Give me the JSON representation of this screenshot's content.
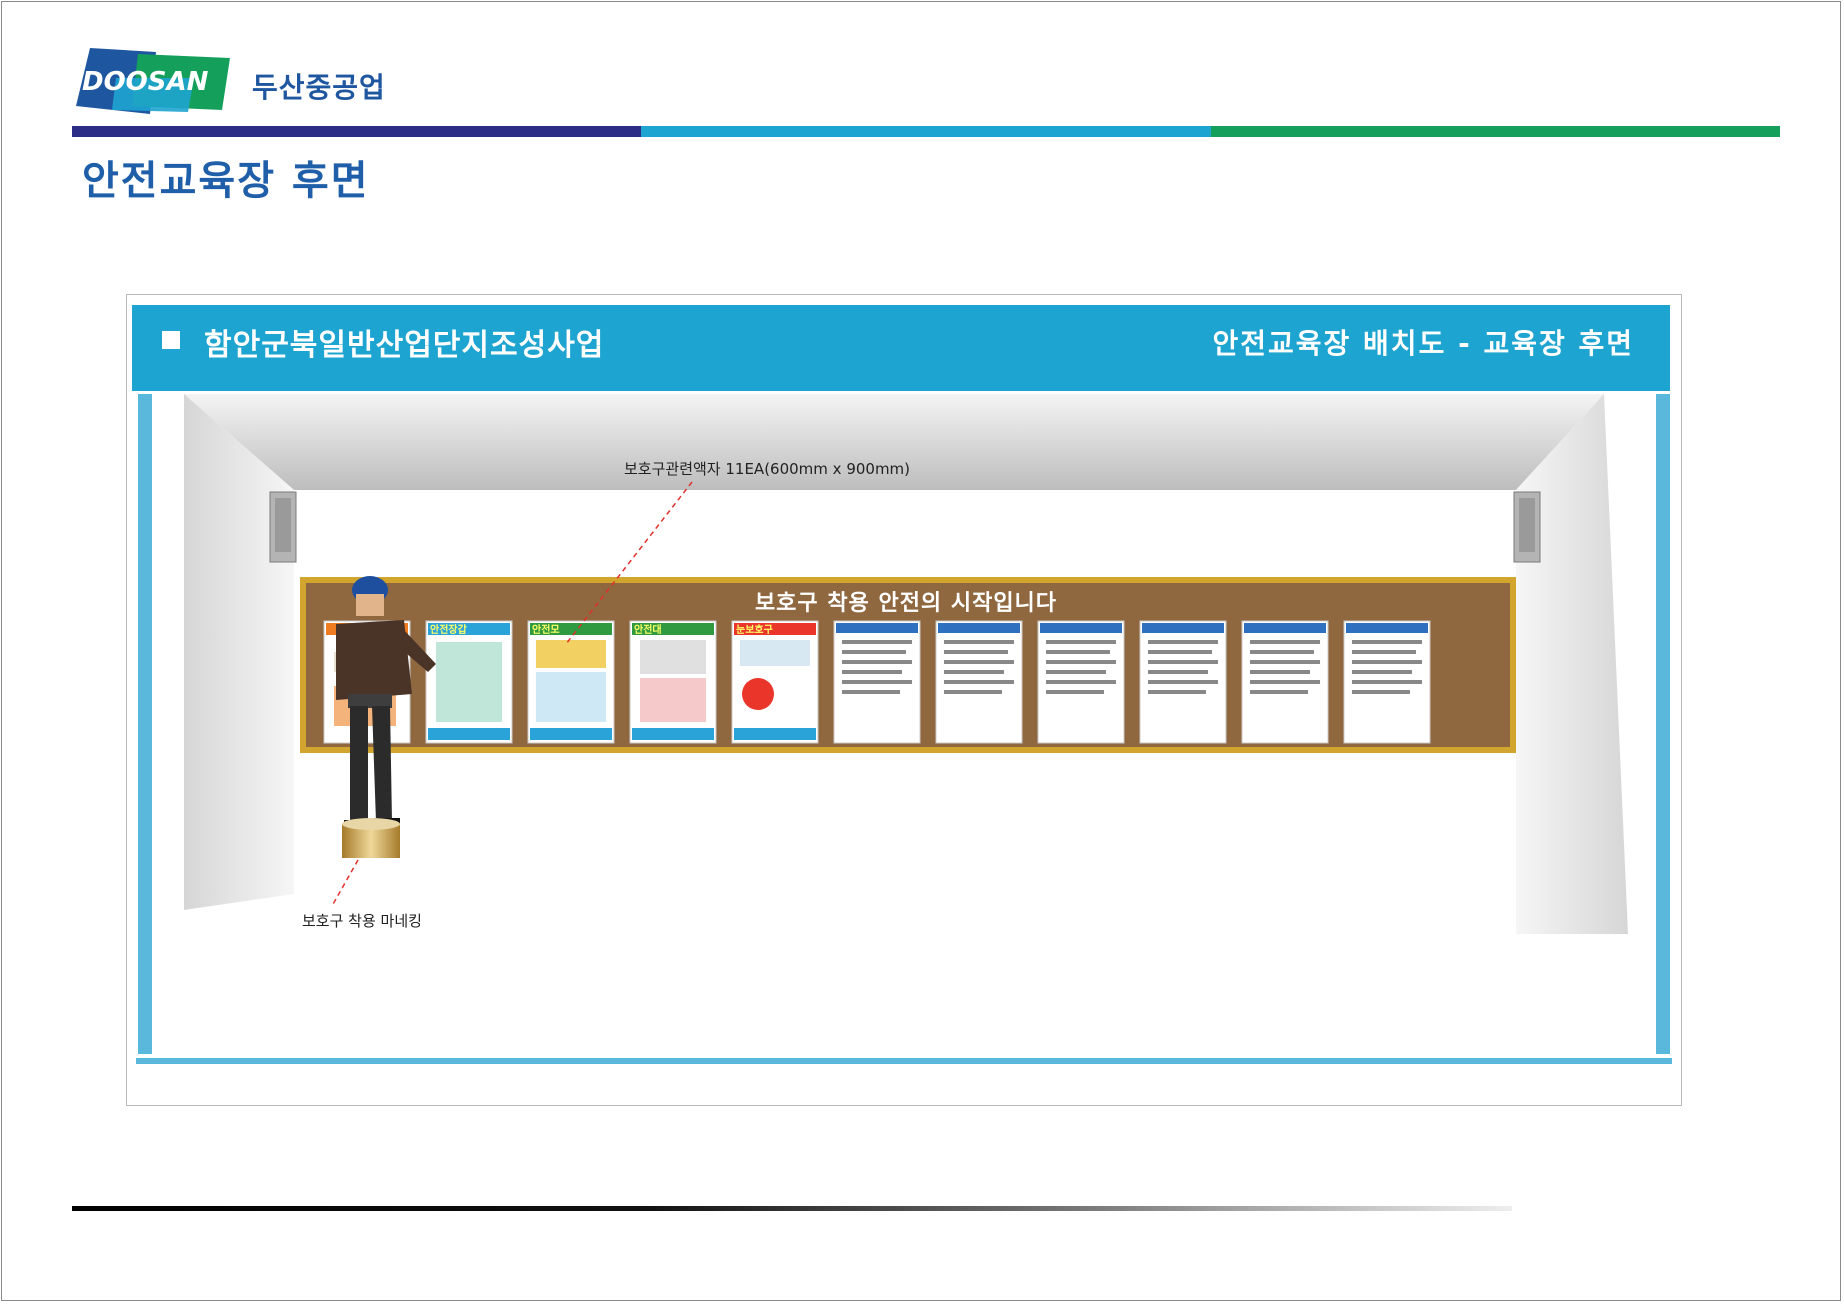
{
  "header": {
    "logo_text": "DOOSAN",
    "company_name": "두산중공업",
    "page_title": "안전교육장 후면",
    "rule_colors": [
      "#2b2d86",
      "#1ea4d0",
      "#14a05a"
    ]
  },
  "banner": {
    "project_name": "함안군북일반산업단지조성사업",
    "layout_title": "안전교육장 배치도 - 교육장 후면",
    "color": "#1ea4d0"
  },
  "drawing": {
    "board_title": "보호구 착용 안전의 시작입니다",
    "frames_label": "보호구관련액자 11EA(600mm x 900mm)",
    "mannequin_label": "보호구 착용 마네킹",
    "frame_headers": [
      "",
      "안전장갑",
      "안전모",
      "안전대",
      "눈보호구",
      "",
      "",
      "",
      "",
      "",
      ""
    ],
    "frame_count": 11
  }
}
